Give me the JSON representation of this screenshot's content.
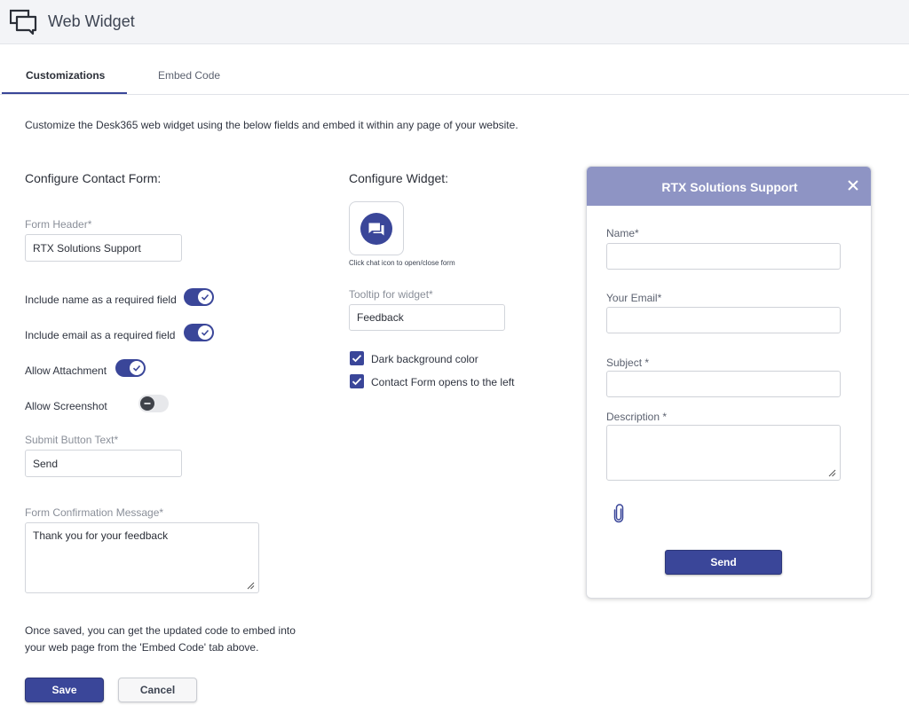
{
  "app": {
    "title": "Web Widget",
    "icon": "chat-bubbles-icon"
  },
  "tabs": [
    {
      "label": "Customizations",
      "active": true
    },
    {
      "label": "Embed Code",
      "active": false
    }
  ],
  "intro": "Customize the Desk365 web widget using the below fields and embed it within any page of your website.",
  "contact_form": {
    "title": "Configure Contact Form:",
    "header_label": "Form Header*",
    "header_value": "RTX Solutions Support",
    "toggles": [
      {
        "label": "Include name as a required field",
        "on": true
      },
      {
        "label": "Include email as a required field",
        "on": true
      },
      {
        "label": "Allow Attachment",
        "on": true
      },
      {
        "label": "Allow Screenshot",
        "on": false
      }
    ],
    "submit_label": "Submit Button Text*",
    "submit_value": "Send",
    "confirmation_label": "Form Confirmation Message*",
    "confirmation_value": "Thank you for your feedback"
  },
  "widget": {
    "title": "Configure Widget:",
    "chat_icon": "chat-icon",
    "chat_caption": "Click chat icon to open/close form",
    "tooltip_label": "Tooltip for widget*",
    "tooltip_value": "Feedback",
    "checkboxes": [
      {
        "label": "Dark background color",
        "checked": true
      },
      {
        "label": "Contact Form opens to the left",
        "checked": true
      }
    ]
  },
  "note": "Once saved, you can get the updated code to embed into your web page from the 'Embed Code' tab above.",
  "buttons": {
    "save": "Save",
    "cancel": "Cancel"
  },
  "preview": {
    "title": "RTX Solutions Support",
    "fields": [
      "Name*",
      "Your Email*",
      "Subject *",
      "Description *"
    ],
    "send": "Send"
  },
  "colors": {
    "accent": "#3a4699",
    "preview_header": "#8e94c4",
    "topbar": "#f3f4f7"
  }
}
